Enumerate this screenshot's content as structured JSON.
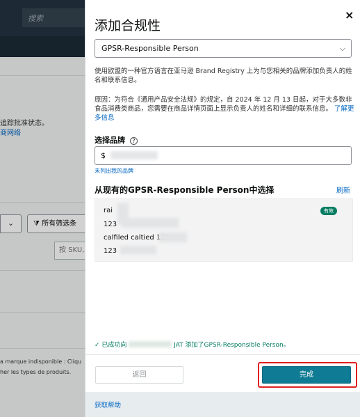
{
  "background": {
    "search_placeholder": "搜索",
    "text_tracking": "追踪批准状态。",
    "link_network": "商网络",
    "select_chevron": "⌄",
    "filter_button": "所有筛选条",
    "sku_placeholder": "按 SKU,",
    "french_line1": "a marque indisponible : Cliqu",
    "french_line2": "her les types de produits."
  },
  "modal": {
    "title": "添加合规性",
    "close_label": "×",
    "selected_type": "GPSR-Responsible Person",
    "description": "使用欧盟的一种官方语言在亚马逊 Brand Registry 上为与您相关的品牌添加负责人的姓名和联系信息。",
    "reason": "原因：为符合《通用产品安全法规》的规定，自 2024 年 12 月 13 日起，对于大多数非食品消费类商品，您需要在商品详情页面上显示负责人的姓名和详细的联系信息。",
    "learn_more": "了解更多信息",
    "brand_label": "选择品牌",
    "help_icon": "?",
    "brand_value": "$",
    "unlisted_brand": "未列出我的品牌",
    "choose_title": "从现有的GPSR-Responsible Person中选择",
    "refresh": "刷新",
    "card": {
      "line1": "rai",
      "line2": "123",
      "line3": "calfiled caltied 123",
      "line4": "123",
      "badge": "有效"
    },
    "success_prefix": "✓  已成功向",
    "success_suffix": "JAT 添加了GPSR-Responsible Person。",
    "back_button": "返回",
    "done_button": "完成",
    "help_link": "获取帮助"
  }
}
